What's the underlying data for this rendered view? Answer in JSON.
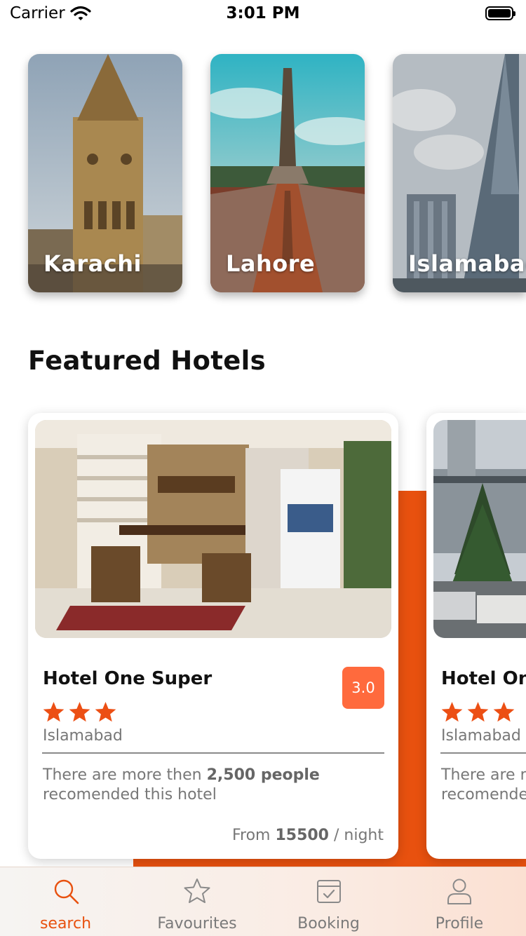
{
  "status_bar": {
    "carrier": "Carrier",
    "time": "3:01 PM"
  },
  "cities": [
    {
      "name": "Karachi"
    },
    {
      "name": "Lahore"
    },
    {
      "name": "Islamabad"
    }
  ],
  "featured": {
    "title": "Featured Hotels"
  },
  "hotels": [
    {
      "name": "Hotel One Super",
      "rating": "3.0",
      "stars": 3,
      "city": "Islamabad",
      "desc_prefix": "There are more then ",
      "desc_count": "2,500 people",
      "desc_suffix": " recomended this hotel",
      "price_prefix": "From ",
      "price": "15500",
      "price_suffix": " / night"
    },
    {
      "name": "Hotel One",
      "stars": 3,
      "city": "Islamabad",
      "desc_prefix": "There are more then ",
      "desc_suffix": "recomended this hotel"
    }
  ],
  "tabs": [
    {
      "label": "search",
      "icon": "search-icon",
      "active": true
    },
    {
      "label": "Favourites",
      "icon": "star-icon",
      "active": false
    },
    {
      "label": "Booking",
      "icon": "calendar-check-icon",
      "active": false
    },
    {
      "label": "Profile",
      "icon": "user-icon",
      "active": false
    }
  ],
  "colors": {
    "accent": "#e8510f",
    "badge": "#ff6a3d",
    "star": "#ec4f14"
  }
}
